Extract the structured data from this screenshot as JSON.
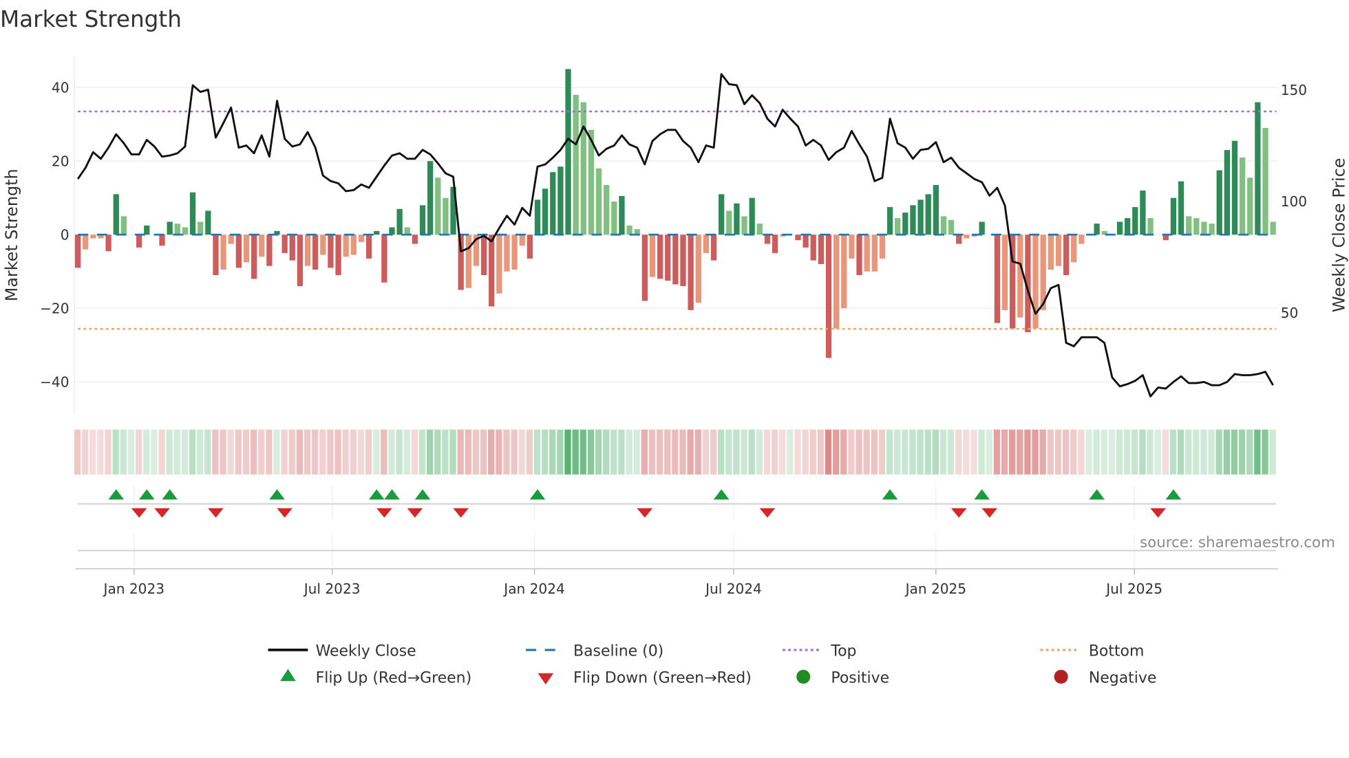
{
  "chart_data": {
    "type": "bar",
    "title": "Market Strength",
    "ylabel": "Market Strength",
    "y2label": "Weekly Close Price",
    "ylim": [
      -48.5,
      48.5
    ],
    "y2lim": [
      5,
      165
    ],
    "yticks": [
      40,
      20,
      0,
      -20,
      -40
    ],
    "y2ticks": [
      150,
      100,
      50
    ],
    "xticks": [
      {
        "label": "Jan 2023",
        "week": 7.34
      },
      {
        "label": "Jul 2023",
        "week": 33.2
      },
      {
        "label": "Jan 2024",
        "week": 59.6
      },
      {
        "label": "Jul 2024",
        "week": 85.6
      },
      {
        "label": "Jan 2025",
        "week": 112.0
      },
      {
        "label": "Jul 2025",
        "week": 137.9
      }
    ],
    "top_level": 33.5,
    "bottom_level": -25.6,
    "baseline": 0,
    "strength": [
      -9,
      -4,
      -1,
      -1,
      -4.5,
      11,
      5,
      0,
      -3.5,
      2.5,
      0,
      -3,
      3.5,
      3,
      2,
      11.5,
      3.5,
      6.5,
      -11,
      -9.5,
      -2.5,
      -9,
      -7.5,
      -12,
      -6,
      -8.5,
      1,
      -5,
      -7,
      -14,
      -8.5,
      -9.5,
      -5.5,
      -9,
      -11,
      -6,
      -5.5,
      -2,
      -6.5,
      1,
      -13,
      2,
      7,
      2,
      -2.5,
      8,
      20,
      15.5,
      10,
      13,
      -15,
      -14.5,
      -8.5,
      -11,
      -19.5,
      -16,
      -10,
      -9.5,
      -3,
      -6.5,
      9.5,
      12.5,
      17,
      18.5,
      45,
      38,
      36,
      28.5,
      18,
      13.5,
      9,
      10.5,
      2.5,
      1.5,
      -18,
      -11.5,
      -12,
      -12.5,
      -13.5,
      -14,
      -20.5,
      -18.5,
      -5,
      -7,
      11,
      6.5,
      8.5,
      5,
      10,
      3,
      -2.5,
      -5,
      -0.5,
      0,
      -1.5,
      -3.5,
      -7,
      -8,
      -33.5,
      -25.5,
      -20,
      -6.5,
      -11,
      -10,
      -10,
      -6.5,
      7.5,
      4.5,
      6,
      8,
      9.5,
      11,
      13.5,
      5,
      4,
      -2.5,
      -1,
      -0.5,
      3.5,
      0,
      -24,
      -20.5,
      -25.5,
      -22.5,
      -26.5,
      -25.5,
      -20.5,
      -9.5,
      -8.5,
      -11,
      -7.5,
      -2.5,
      0,
      3,
      1,
      0,
      3.5,
      4.5,
      7.5,
      12,
      4.5,
      0,
      -1.5,
      10,
      14.5,
      5,
      4.5,
      3.5,
      3,
      17.5,
      23,
      25.5,
      21,
      15.5,
      36,
      29,
      3.5
    ],
    "weekly_close": [
      110,
      115,
      122,
      119,
      124,
      130,
      126,
      121,
      121,
      127.5,
      124.5,
      120,
      120.5,
      121.5,
      124.5,
      152,
      149,
      150,
      128.5,
      135,
      142,
      124,
      125,
      121.5,
      129.5,
      120,
      145,
      128,
      124.5,
      125.5,
      131,
      124,
      111.5,
      109,
      108,
      104.5,
      105,
      107.5,
      106,
      111,
      116,
      120.5,
      121.5,
      119,
      119,
      123,
      121,
      117,
      112.5,
      111,
      77.5,
      79,
      83,
      84.5,
      82,
      88,
      93.5,
      89.5,
      97,
      93.5,
      115.5,
      116.5,
      119.5,
      123,
      128,
      125.5,
      133.5,
      127.5,
      120.5,
      123.5,
      125,
      129.5,
      125.5,
      124,
      116.5,
      127,
      130,
      132,
      132,
      127,
      124,
      117.5,
      125,
      124,
      157,
      152.5,
      152,
      143.5,
      147.5,
      144,
      137,
      133.5,
      141,
      137,
      133.5,
      125,
      127.5,
      125,
      118.5,
      122,
      124,
      131.5,
      125.5,
      120,
      109,
      110.5,
      137,
      126,
      124,
      119,
      123,
      123.5,
      126.5,
      117.5,
      119.5,
      115,
      112.5,
      110,
      108.5,
      102.5,
      106,
      98,
      73,
      72,
      60,
      49.5,
      54,
      61,
      62.5,
      36.5,
      35,
      39,
      39,
      39,
      36.5,
      21,
      17,
      18,
      19.5,
      22,
      12.5,
      16.5,
      16,
      19,
      21.5,
      18.5,
      18.5,
      19,
      17.5,
      17.5,
      19,
      22.5,
      22,
      22,
      22.5,
      23.5,
      17.5
    ],
    "flip_up_weeks": [
      5,
      9,
      12,
      26,
      39,
      41,
      45,
      60,
      84,
      106,
      118,
      133,
      143
    ],
    "flip_down_weeks": [
      8,
      11,
      18,
      27,
      40,
      44,
      50,
      74,
      90,
      115,
      119,
      141
    ],
    "legend": {
      "weekly_close": "Weekly Close",
      "baseline": "Baseline (0)",
      "top": "Top",
      "bottom": "Bottom",
      "flip_up": "Flip Up (Red→Green)",
      "flip_down": "Flip Down (Green→Red)",
      "positive": "Positive",
      "negative": "Negative"
    },
    "legend_placement": "bottom",
    "source": "source: sharemaestro.com",
    "colors": {
      "pos_up": "#2e8b57",
      "pos_down": "#80c080",
      "neg_down": "#cd5c5c",
      "neg_up": "#e9967a",
      "close": "#111111",
      "baseline": "#1f77b4",
      "top": "#9b6ddb",
      "bottom": "#f0a060",
      "flip_up": "#1a9c3e",
      "flip_down": "#d62728",
      "positive": "#228b22",
      "negative": "#b22222"
    }
  }
}
